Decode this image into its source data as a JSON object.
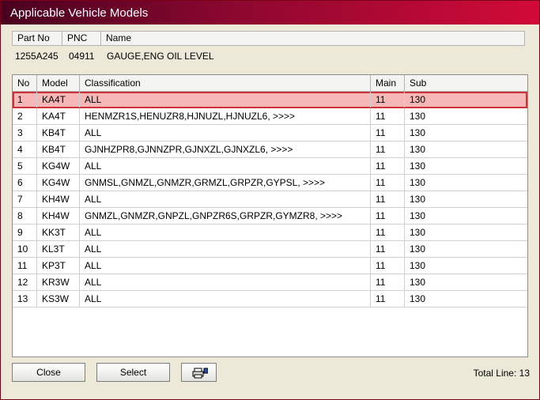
{
  "window": {
    "title": "Applicable Vehicle Models"
  },
  "part": {
    "headers": {
      "part_no": "Part No",
      "pnc": "PNC",
      "name": "Name"
    },
    "values": {
      "part_no": "1255A245",
      "pnc": "04911",
      "name": "GAUGE,ENG OIL LEVEL"
    }
  },
  "table": {
    "headers": {
      "no": "No",
      "model": "Model",
      "classification": "Classification",
      "main": "Main",
      "sub": "Sub"
    },
    "selected_index": 0,
    "rows": [
      {
        "no": "1",
        "model": "KA4T",
        "classification": "ALL",
        "main": "11",
        "sub": "130"
      },
      {
        "no": "2",
        "model": "KA4T",
        "classification": "HENMZR1S,HENUZR8,HJNUZL,HJNUZL6,  >>>>",
        "main": "11",
        "sub": "130"
      },
      {
        "no": "3",
        "model": "KB4T",
        "classification": "ALL",
        "main": "11",
        "sub": "130"
      },
      {
        "no": "4",
        "model": "KB4T",
        "classification": "GJNHZPR8,GJNNZPR,GJNXZL,GJNXZL6,  >>>>",
        "main": "11",
        "sub": "130"
      },
      {
        "no": "5",
        "model": "KG4W",
        "classification": "ALL",
        "main": "11",
        "sub": "130"
      },
      {
        "no": "6",
        "model": "KG4W",
        "classification": "GNMSL,GNMZL,GNMZR,GRMZL,GRPZR,GYPSL,  >>>>",
        "main": "11",
        "sub": "130"
      },
      {
        "no": "7",
        "model": "KH4W",
        "classification": "ALL",
        "main": "11",
        "sub": "130"
      },
      {
        "no": "8",
        "model": "KH4W",
        "classification": "GNMZL,GNMZR,GNPZL,GNPZR6S,GRPZR,GYMZR8,  >>>>",
        "main": "11",
        "sub": "130"
      },
      {
        "no": "9",
        "model": "KK3T",
        "classification": "ALL",
        "main": "11",
        "sub": "130"
      },
      {
        "no": "10",
        "model": "KL3T",
        "classification": "ALL",
        "main": "11",
        "sub": "130"
      },
      {
        "no": "11",
        "model": "KP3T",
        "classification": "ALL",
        "main": "11",
        "sub": "130"
      },
      {
        "no": "12",
        "model": "KR3W",
        "classification": "ALL",
        "main": "11",
        "sub": "130"
      },
      {
        "no": "13",
        "model": "KS3W",
        "classification": "ALL",
        "main": "11",
        "sub": "130"
      }
    ]
  },
  "footer": {
    "close_label": "Close",
    "select_label": "Select",
    "print_icon": "printer-icon",
    "total_label": "Total Line: 13"
  },
  "colors": {
    "title_start": "#4a0020",
    "title_end": "#d20a38",
    "selected_row": "#f7b7b7",
    "selected_border": "#d0303a"
  }
}
